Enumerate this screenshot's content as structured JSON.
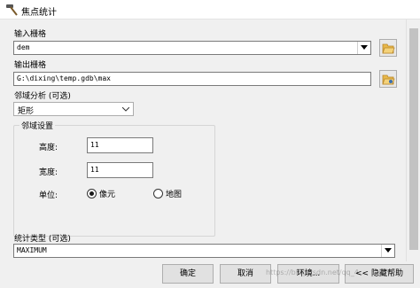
{
  "window": {
    "title": "焦点统计",
    "icon": "hammer-icon"
  },
  "fields": {
    "input_raster": {
      "label": "输入栅格",
      "value": "dem"
    },
    "output_raster": {
      "label": "输出栅格",
      "value": "G:\\dixing\\temp.gdb\\max"
    },
    "neighborhood": {
      "label": "邻域分析 (可选)",
      "selected": "矩形"
    },
    "neighborhood_settings": {
      "legend": "邻域设置",
      "height_label": "高度:",
      "height_value": "11",
      "width_label": "宽度:",
      "width_value": "11",
      "units_label": "单位:",
      "unit_cell": "像元",
      "unit_map": "地图",
      "selected_unit": "像元"
    },
    "statistics_type": {
      "label": "统计类型 (可选)",
      "value": "MAXIMUM"
    }
  },
  "buttons": {
    "ok": "确定",
    "cancel": "取消",
    "environments": "环境...",
    "hide_help": "<< 隐藏帮助"
  },
  "watermark": "https://blog.csdn.net/qq_4...",
  "colors": {
    "folder": "#e8b84a",
    "folder_dark": "#b8862a",
    "folder_blue": "#3a6fb0"
  }
}
